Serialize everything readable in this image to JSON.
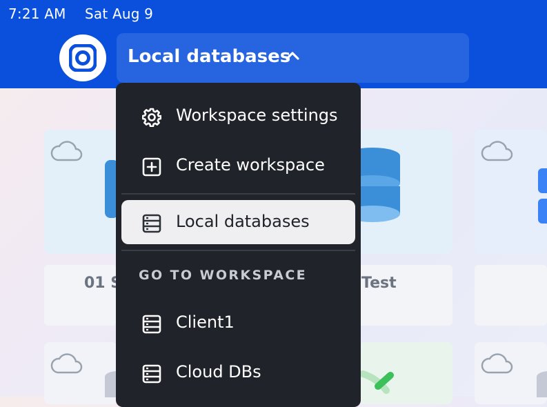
{
  "status_bar": {
    "time": "7:21 AM",
    "date": "Sat Aug 9"
  },
  "header": {
    "workspace_title": "Local databases",
    "logo_icon": "app-logo-icon",
    "chevron_icon": "chevron-up-icon"
  },
  "colors": {
    "header_bg": "#0a50dc",
    "menu_bg": "#202329",
    "menu_selected_bg": "#efeff1"
  },
  "menu": {
    "workspace_settings": {
      "label": "Workspace settings",
      "icon": "gear-icon"
    },
    "create_workspace": {
      "label": "Create workspace",
      "icon": "plus-square-icon"
    },
    "local_databases": {
      "label": "Local databases",
      "icon": "database-list-icon",
      "selected": true
    },
    "section_label": "GO TO WORKSPACE",
    "workspaces": [
      {
        "label": "Client1",
        "icon": "database-list-icon"
      },
      {
        "label": "Cloud DBs",
        "icon": "database-list-icon"
      }
    ]
  },
  "background_cards": {
    "card_a_text": "01 S",
    "card_b_text": "Test"
  }
}
